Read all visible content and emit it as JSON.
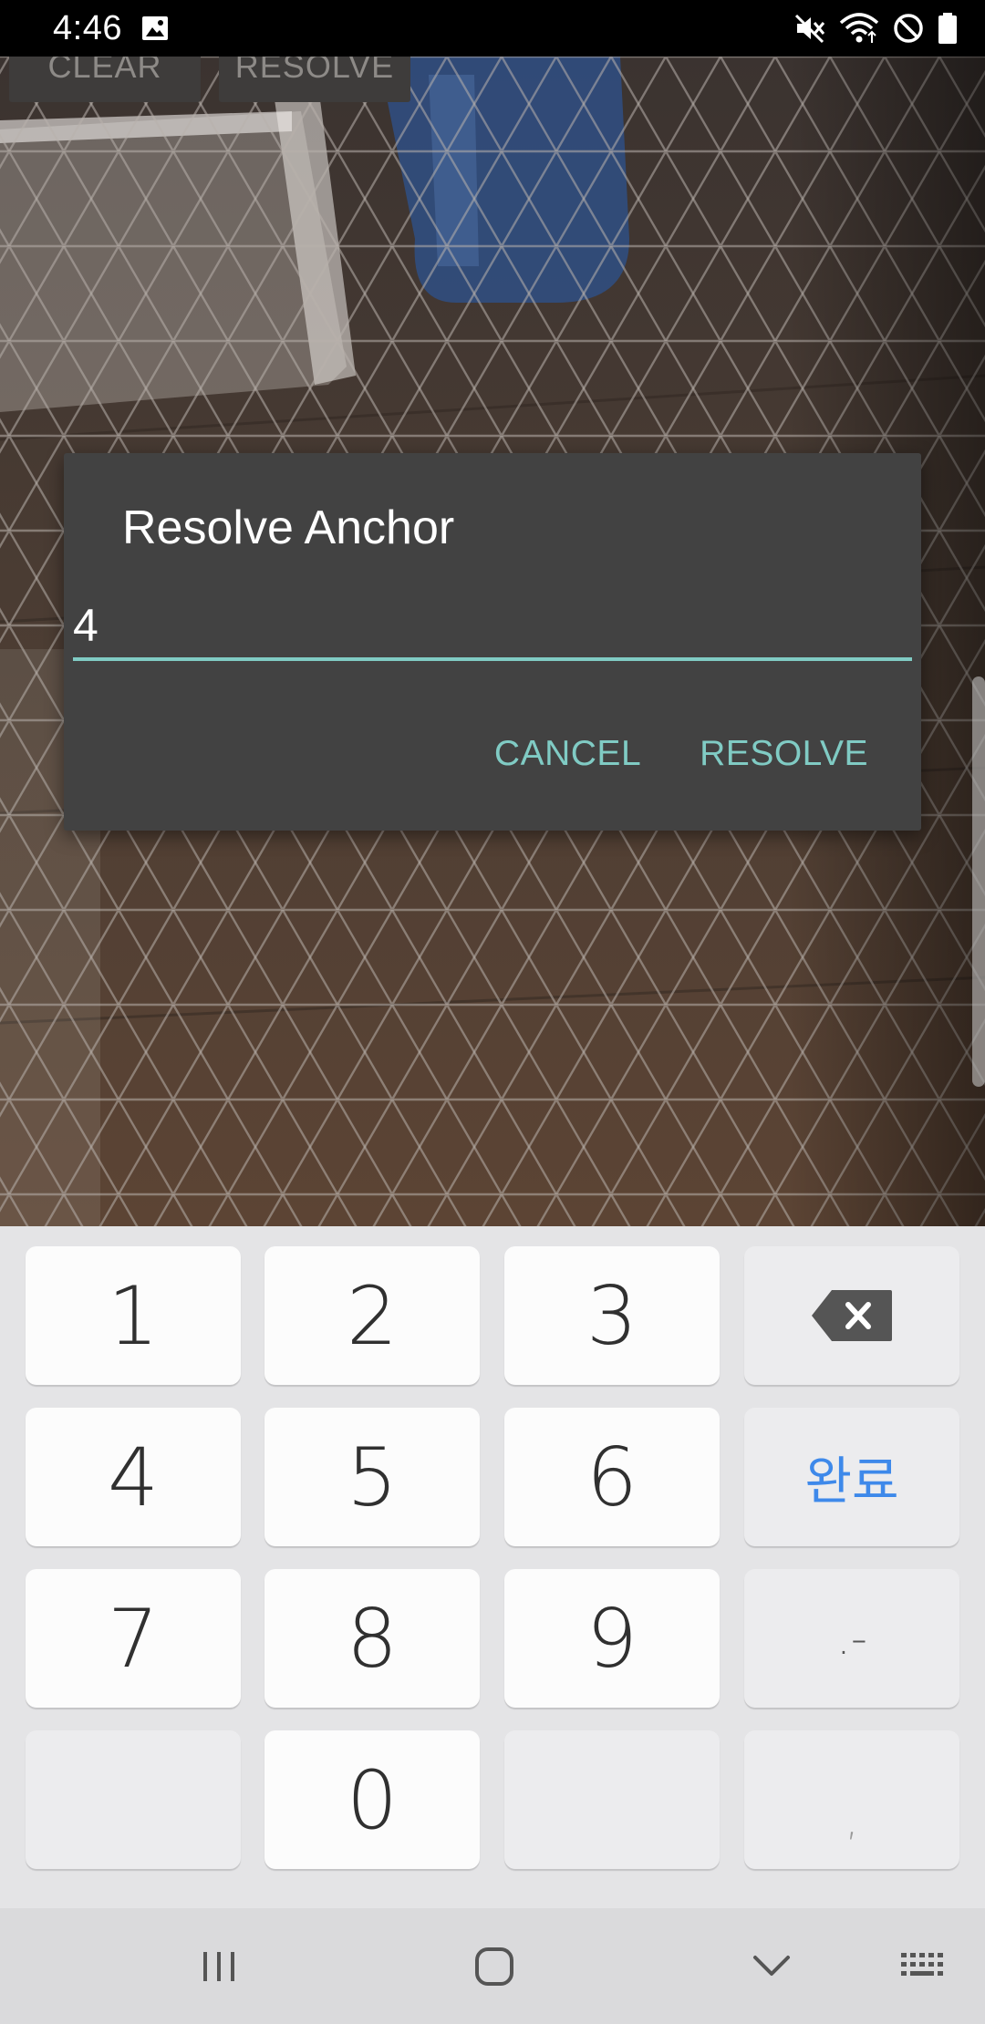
{
  "status_bar": {
    "time": "4:46",
    "icons": [
      "gallery-icon",
      "mute-icon",
      "wifi-icon",
      "do-not-disturb-icon",
      "battery-icon"
    ]
  },
  "app": {
    "top_buttons": {
      "clear_label": "CLEAR",
      "resolve_label": "RESOLVE"
    }
  },
  "dialog": {
    "title": "Resolve Anchor",
    "input_value": "4",
    "cancel_label": "CANCEL",
    "resolve_label": "RESOLVE"
  },
  "keyboard": {
    "keys": {
      "k1": "1",
      "k2": "2",
      "k3": "3",
      "k4": "4",
      "k5": "5",
      "k6": "6",
      "k7": "7",
      "k8": "8",
      "k9": "9",
      "k0": "0",
      "done": "완료",
      "punct": ".-",
      "comma": ","
    }
  },
  "nav_bar": {
    "icons": [
      "recent-apps-icon",
      "home-icon",
      "hide-keyboard-icon",
      "keyboard-switch-icon"
    ]
  },
  "colors": {
    "accent": "#80cbc4",
    "dialog_bg": "#424242",
    "keyboard_bg": "#e4e4e6",
    "done_blue": "#3e89ea"
  }
}
